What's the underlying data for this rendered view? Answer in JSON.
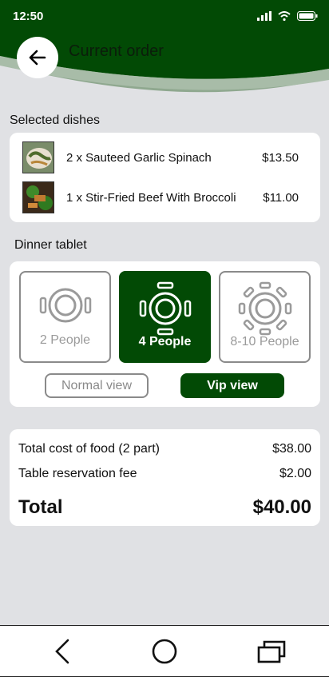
{
  "status_bar": {
    "time": "12:50"
  },
  "header": {
    "title": "Current order"
  },
  "colors": {
    "brand": "#024a05",
    "background": "#e0e1e4"
  },
  "dishes_section": {
    "label": "Selected dishes",
    "items": [
      {
        "name": "2 x Sauteed Garlic Spinach",
        "price": "$13.50"
      },
      {
        "name": "1 x Stir-Fried Beef With Broccoli",
        "price": "$11.00"
      }
    ]
  },
  "table_section": {
    "label": "Dinner tablet",
    "options": [
      {
        "label": "2 People",
        "selected": false
      },
      {
        "label": "4 People",
        "selected": true
      },
      {
        "label": "8-10 People",
        "selected": false
      }
    ],
    "views": {
      "normal": "Normal view",
      "vip": "Vip view"
    }
  },
  "summary": {
    "food_label": "Total cost of food (2 part)",
    "food_value": "$38.00",
    "fee_label": "Table reservation fee",
    "fee_value": "$2.00",
    "total_label": "Total",
    "total_value": "$40.00"
  },
  "icons": {
    "back": "arrow-left-icon",
    "signal": "signal-icon",
    "wifi": "wifi-icon",
    "battery": "battery-icon",
    "nav_back": "chevron-left-icon",
    "nav_home": "circle-home-icon",
    "nav_recent": "recent-apps-icon"
  }
}
